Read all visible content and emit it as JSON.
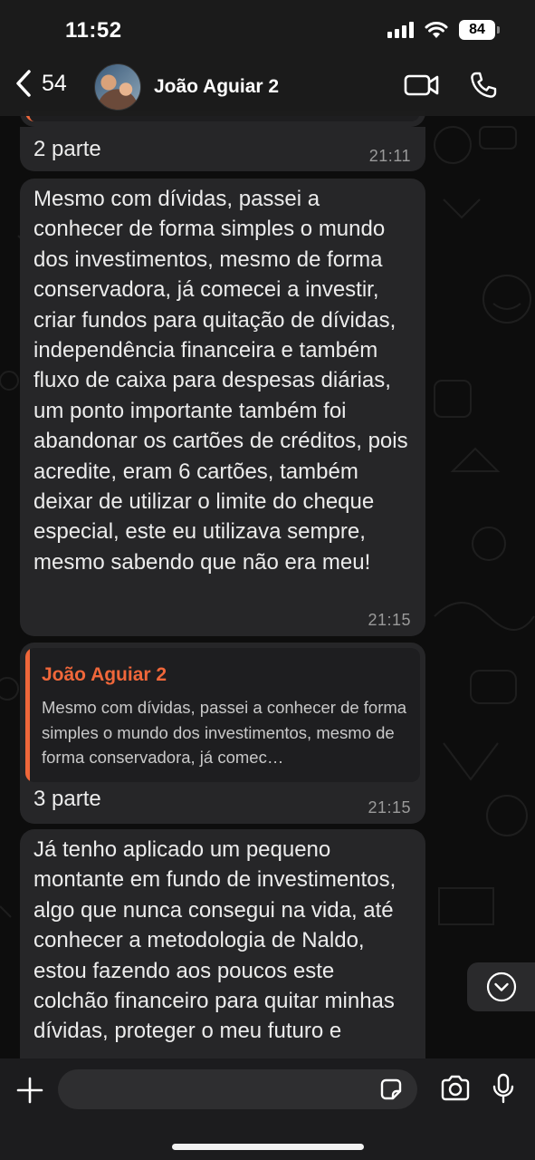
{
  "status_bar": {
    "time": "11:52",
    "battery": "84"
  },
  "header": {
    "back_count": "54",
    "contact_name": "João Aguiar 2",
    "icons": [
      "chevron-left-icon",
      "video-camera-icon",
      "phone-icon"
    ]
  },
  "messages": [
    {
      "text": "2 parte",
      "time": "21:11"
    },
    {
      "text": "Mesmo com dívidas, passei a conhecer de forma simples o mundo dos investimentos, mesmo de forma conservadora, já comecei a investir, criar fundos para quitação de dívidas, independência financeira e também fluxo de caixa para despesas diárias, um ponto importante também foi abandonar os cartões de créditos, pois acredite, eram 6 cartões, também deixar de utilizar o limite do cheque especial, este eu utilizava sempre, mesmo sabendo que não era meu!",
      "time": "21:15"
    },
    {
      "quote": {
        "author": "João Aguiar 2",
        "text": "Mesmo com dívidas, passei a conhecer de forma simples o mundo dos investimentos, mesmo de forma conservadora, já comec…"
      },
      "text": "3 parte",
      "time": "21:15"
    },
    {
      "text": "Já tenho aplicado um pequeno montante em fundo de investimentos, algo que nunca consegui na vida, até conhecer a metodologia de Naldo, estou fazendo aos poucos este colchão financeiro para quitar minhas dívidas, proteger o meu futuro e"
    }
  ],
  "colors": {
    "bubble": "#262628",
    "quote_accent": "#f0673a",
    "background": "#0d0d0d"
  },
  "input": {
    "placeholder": ""
  }
}
